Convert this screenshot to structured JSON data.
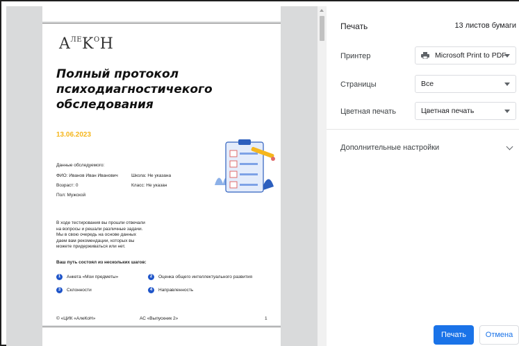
{
  "document": {
    "logo": {
      "a": "A",
      "sup1": "ЛЕ",
      "k": "K",
      "sup2": "О",
      "h": "H"
    },
    "title": "Полный протокол психодиагностичекого обследования",
    "date": "13.06.2023",
    "subject_header": "Данные обследуемого:",
    "fio": "ФИО: Иванов Иван Иванович",
    "school": "Школа: Не указана",
    "age": "Возраст: 0",
    "class": "Класс: Не указан",
    "gender": "Пол: Мужской",
    "intro": "В ходе тестирования вы прошли отвечали\nна вопросы и решали различные задачи.\nМы в свою очередь на основе данных\nдаем вам рекомендации, которых вы\nможете придерживаться или нет.",
    "steps_header": "Ваш путь состоял из нескольких шагов:",
    "steps": [
      {
        "num": "1",
        "label": "Анкета «Мои предметы»"
      },
      {
        "num": "2",
        "label": "Оценка общего интеллектуального развития"
      },
      {
        "num": "3",
        "label": "Склонности"
      },
      {
        "num": "4",
        "label": "Направленность"
      }
    ],
    "footer_left": "© «ЦИК «АлеКоН»",
    "footer_center": "АС «Выпускник 2»",
    "footer_page": "1"
  },
  "panel": {
    "title": "Печать",
    "sheets": "13 листов бумаги",
    "printer_label": "Принтер",
    "printer_value": "Microsoft Print to PDF",
    "pages_label": "Страницы",
    "pages_value": "Все",
    "color_label": "Цветная печать",
    "color_value": "Цветная печать",
    "more_settings": "Дополнительные настройки",
    "print_button": "Печать",
    "cancel_button": "Отмена"
  },
  "colors": {
    "accent": "#1a73e8",
    "date": "#f5b61c",
    "step_badge": "#1f55c9"
  }
}
